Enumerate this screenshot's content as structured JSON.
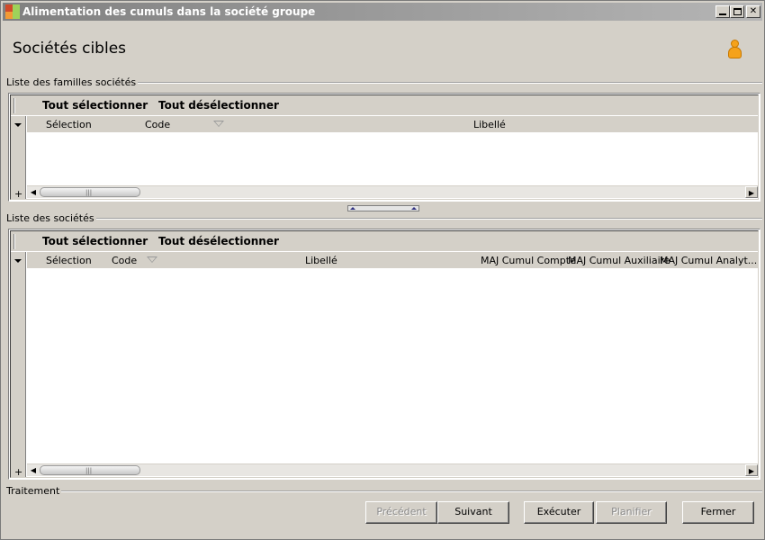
{
  "window": {
    "title": "Alimentation des cumuls dans la société groupe",
    "controls": {
      "minimize": "minimize-icon",
      "maximize": "maximize-icon",
      "close": "close-icon"
    }
  },
  "header": {
    "title": "Sociétés cibles",
    "user_icon": "user-icon"
  },
  "families_panel": {
    "label": "Liste des familles sociétés",
    "select_all": "Tout sélectionner",
    "deselect_all": "Tout désélectionner",
    "columns": [
      "Sélection",
      "Code",
      "Libellé"
    ],
    "add": "+"
  },
  "companies_panel": {
    "label": "Liste des sociétés",
    "select_all": "Tout sélectionner",
    "deselect_all": "Tout désélectionner",
    "columns": [
      "Sélection",
      "Code",
      "Libellé",
      "MAJ Cumul Compte",
      "MAJ Cumul Auxiliaire",
      "MAJ Cumul Analyt..."
    ],
    "add": "+"
  },
  "processing": {
    "label": "Traitement",
    "buttons": {
      "previous": "Précédent",
      "next": "Suivant",
      "execute": "Exécuter",
      "schedule": "Planifier",
      "close": "Fermer"
    }
  },
  "colors": {
    "titlebar_start": "#808080",
    "titlebar_end": "#b5b5b5",
    "window_bg": "#d4d0c8",
    "disabled_text": "#8a8a8a"
  }
}
